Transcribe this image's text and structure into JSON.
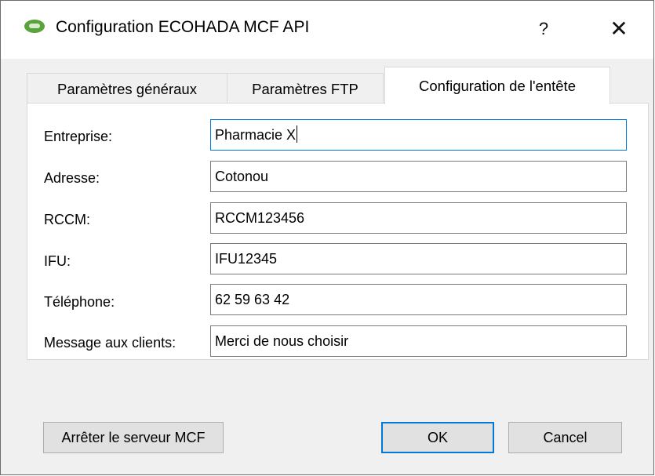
{
  "window": {
    "title": "Configuration ECOHADA MCF API",
    "help_label": "?",
    "close_label": "✕",
    "app_icon": "ecohada-logo-icon"
  },
  "tabs": [
    {
      "label": "Paramètres généraux",
      "active": false
    },
    {
      "label": "Paramètres FTP",
      "active": false
    },
    {
      "label": "Configuration de l'entête",
      "active": true
    }
  ],
  "form": {
    "fields": [
      {
        "label": "Entreprise:",
        "value": "Pharmacie X"
      },
      {
        "label": "Adresse:",
        "value": "Cotonou"
      },
      {
        "label": "RCCM:",
        "value": "RCCM123456"
      },
      {
        "label": "IFU:",
        "value": "IFU12345"
      },
      {
        "label": "Téléphone:",
        "value": "62 59 63 42"
      },
      {
        "label": "Message aux clients:",
        "value": "Merci de nous choisir"
      }
    ]
  },
  "buttons": {
    "stop_server": "Arrêter le serveur MCF",
    "ok": "OK",
    "cancel": "Cancel"
  },
  "colors": {
    "focus_accent": "#0078d7",
    "app_icon_green": "#5aa33a"
  }
}
